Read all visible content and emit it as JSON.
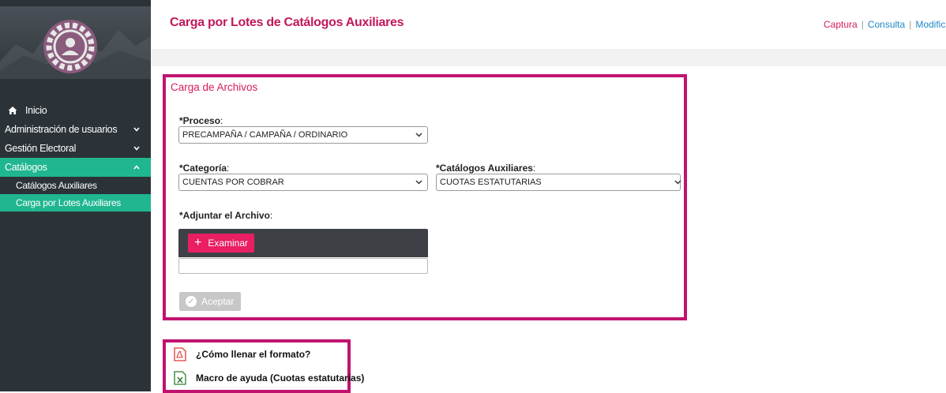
{
  "header": {
    "title": "Carga por Lotes de Catálogos Auxiliares",
    "links": [
      "Captura",
      "Consulta",
      "Modific"
    ],
    "separator": "|"
  },
  "sidebar": {
    "items": [
      {
        "label": "Inicio",
        "icon": "home-icon"
      },
      {
        "label": "Administración de usuarios",
        "icon": "chevron-down-icon"
      },
      {
        "label": "Gestión Electoral",
        "icon": "chevron-down-icon"
      },
      {
        "label": "Catálogos",
        "icon": "chevron-up-icon",
        "active": true
      }
    ],
    "subitems": [
      {
        "label": "Catálogos Auxiliares"
      },
      {
        "label": "Carga por Lotes Auxiliares",
        "active": true
      }
    ]
  },
  "form": {
    "section_title": "Carga de Archivos",
    "proceso": {
      "label": "*Proceso",
      "value": "PRECAMPAÑA / CAMPAÑA / ORDINARIO"
    },
    "categoria": {
      "label": "*Categoría",
      "value": "CUENTAS POR COBRAR"
    },
    "catalogos": {
      "label": "*Catálogos Auxiliares",
      "value": "CUOTAS ESTATUTARIAS"
    },
    "adjuntar": {
      "label": "*Adjuntar el Archivo"
    },
    "colon": ":",
    "examinar_label": "Examinar",
    "aceptar_label": "Aceptar"
  },
  "help": {
    "links": [
      {
        "label": "¿Cómo llenar el formato?",
        "icon": "pdf-icon"
      },
      {
        "label": "Macro de ayuda (Cuotas estatutarias)",
        "icon": "excel-icon"
      }
    ]
  },
  "colors": {
    "accent": "#c2185b",
    "frame": "#c0136f",
    "active_nav": "#20b690",
    "sidebar": "#2b3338",
    "button": "#e91e63"
  }
}
